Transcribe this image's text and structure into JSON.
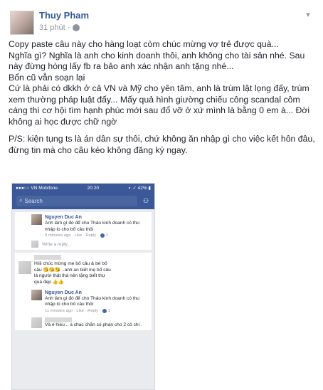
{
  "post": {
    "author": "Thuy Pham",
    "time": "31 phút ·",
    "menu_icon": "chevron-down-icon",
    "paragraphs": [
      "Copy paste câu này cho hàng loạt còm chúc mừng vợ trẻ được quà...",
      "Nghĩa gì? Nghĩa là anh cho kinh doanh thôi, anh không cho tài sản nhé. Sau này đừng hòng lấy fb ra bảo anh xác nhận anh tặng nhé...",
      "Bổn cũ vẫn soạn lại",
      "Cứ là phải có dkkh ở cả VN và Mỹ cho yên tâm, anh là trùm lật lọng đấy, trùm xem thường pháp luật đấy... Mấy quả hình giường chiếu công scandal côm cáng thì cơ hội tìm hạnh phúc mới sau đổ vỡ ở xứ mình là bằng 0 em à... Đời không ai học được chữ ngờ"
    ],
    "ps": "P/S: kiện tụng ts là án dân sự thôi, chứ không ăn nhập gì cho việc kết hôn đâu, đừng tin mà cho câu kéo không đăng ký ngay."
  },
  "screenshot": {
    "carrier": "●●●○○ VN Mobifone",
    "clock": "20:20",
    "battery": "◐ ✓ 42% ▮",
    "search_placeholder": "Search",
    "comment1": {
      "name": "Nguyen Duc An",
      "text": "Anh  làm gì đó để cho Thảo kinh doanh có thu nhập lo cho bố câu thôi",
      "meta": "9 minutes ago · Like · Reply · ",
      "likes": "2"
    },
    "write_reply": "Write a reply...",
    "comment2": {
      "text": "Hiiii chúc mừng mẹ bố câu & bé bố câu 😘😘😘 ..anh an biết mẹ bố câu là người thật thà nên tặng biết thự quá đẹp 👍👍"
    },
    "comment3": {
      "name": "Nguyen Duc An",
      "text": "Anh  làm gì đó để cho Thảo kinh doanh có thu nhập lo cho bố câu thôi",
      "meta": "11 minutes ago · Like · Reply · ",
      "likes": "1"
    },
    "comment4": {
      "text": "Và e hieu .. a chac chăn có phan cho 2 cô chi ."
    }
  }
}
